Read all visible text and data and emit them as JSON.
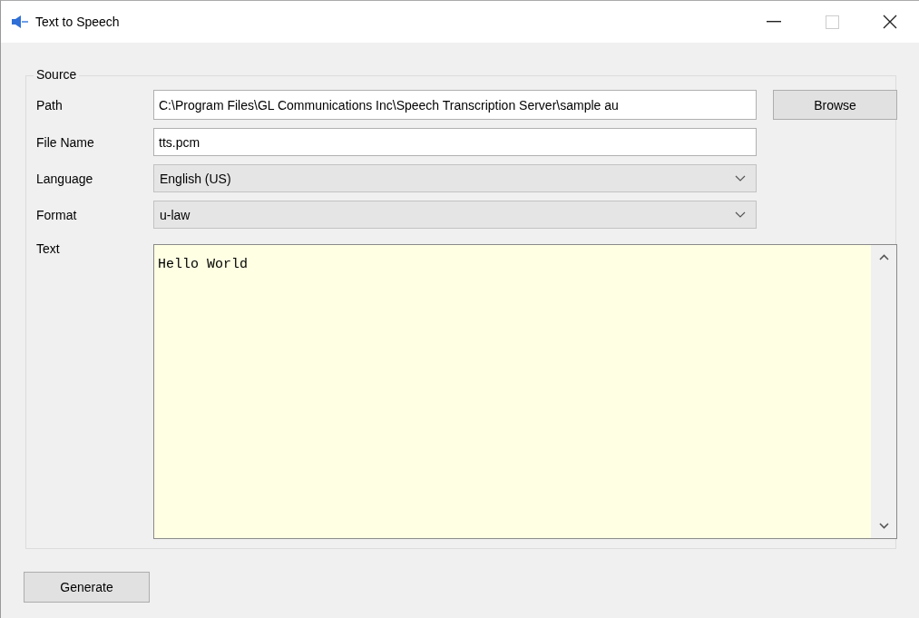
{
  "window": {
    "title": "Text to Speech",
    "controls": [
      {
        "kind": "minimize",
        "disabled": false
      },
      {
        "kind": "maximize",
        "disabled": true
      },
      {
        "kind": "close",
        "disabled": false
      }
    ]
  },
  "source": {
    "legend": "Source",
    "fields": [
      {
        "kind": "text",
        "label": "Path",
        "value": "C:\\Program Files\\GL Communications Inc\\Speech Transcription Server\\sample au"
      },
      {
        "kind": "text",
        "label": "File Name",
        "value": "tts.pcm"
      },
      {
        "kind": "dropdown",
        "label": "Language",
        "value": "English (US)"
      },
      {
        "kind": "dropdown",
        "label": "Format",
        "value": "u-law"
      }
    ],
    "browse_button": "Browse",
    "text": {
      "label": "Text",
      "value": "Hello World"
    }
  },
  "generate_button": "Generate"
}
